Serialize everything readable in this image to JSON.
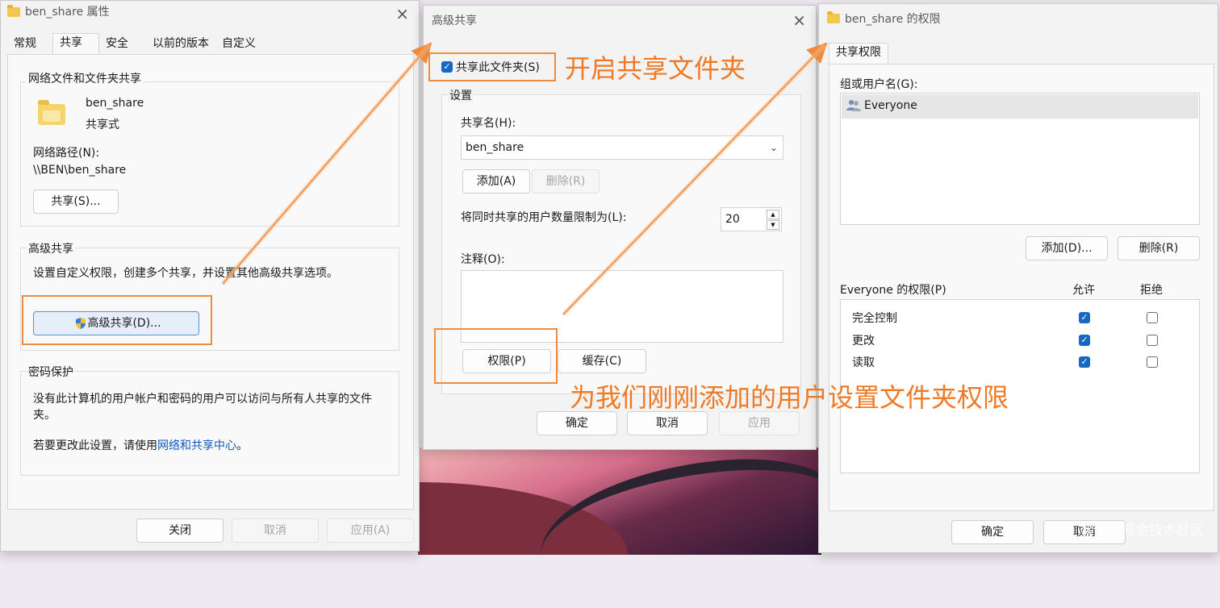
{
  "dialog1": {
    "title": "ben_share 属性",
    "tabs": [
      "常规",
      "共享",
      "安全",
      "以前的版本",
      "自定义"
    ],
    "net_group": "网络文件和文件夹共享",
    "folder_name": "ben_share",
    "folder_status": "共享式",
    "net_path_label": "网络路径(N):",
    "net_path": "\\\\BEN\\ben_share",
    "share_btn": "共享(S)...",
    "adv_group": "高级共享",
    "adv_desc": "设置自定义权限，创建多个共享，并设置其他高级共享选项。",
    "adv_btn": "高级共享(D)...",
    "pwd_group": "密码保护",
    "pwd_desc": "没有此计算机的用户帐户和密码的用户可以访问与所有人共享的文件夹。",
    "pwd_change_prefix": "若要更改此设置，请使用",
    "pwd_link": "网络和共享中心",
    "pwd_change_suffix": "。",
    "close_btn": "关闭",
    "cancel_btn": "取消",
    "apply_btn": "应用(A)"
  },
  "dialog2": {
    "title": "高级共享",
    "share_check": "共享此文件夹(S)",
    "settings_group": "设置",
    "share_name_label": "共享名(H):",
    "share_name_value": "ben_share",
    "add_btn": "添加(A)",
    "remove_btn": "删除(R)",
    "limit_label": "将同时共享的用户数量限制为(L):",
    "limit_value": "20",
    "comment_label": "注释(O):",
    "perm_btn": "权限(P)",
    "cache_btn": "缓存(C)",
    "ok_btn": "确定",
    "cancel_btn": "取消",
    "apply_btn": "应用"
  },
  "dialog3": {
    "title": "ben_share 的权限",
    "tab": "共享权限",
    "group_label": "组或用户名(G):",
    "users": [
      "Everyone"
    ],
    "add_btn": "添加(D)...",
    "remove_btn": "删除(R)",
    "perm_label": "Everyone 的权限(P)",
    "allow_col": "允许",
    "deny_col": "拒绝",
    "perms": [
      {
        "name": "完全控制",
        "allow": true,
        "deny": false
      },
      {
        "name": "更改",
        "allow": true,
        "deny": false
      },
      {
        "name": "读取",
        "allow": true,
        "deny": false
      }
    ],
    "ok_btn": "确定",
    "cancel_btn": "取消"
  },
  "annotations": {
    "enable": "开启共享文件夹",
    "perm": "为我们刚刚添加的用户设置文件夹权限"
  },
  "watermark": "@稀土掘金技术社区",
  "colors": {
    "annotation": "#ef7a26",
    "accent": "#1668c4",
    "link": "#0b5bbf"
  }
}
